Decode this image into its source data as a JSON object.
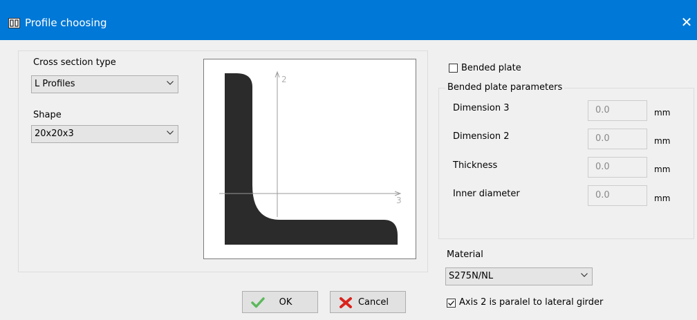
{
  "window": {
    "title": "Profile choosing",
    "close_glyph": "✕",
    "app_icon": "profile-app-icon"
  },
  "cross_section": {
    "label": "Cross section type",
    "value": "L Profiles"
  },
  "shape": {
    "label": "Shape",
    "value": "20x20x3"
  },
  "preview": {
    "axis_vertical": "2",
    "axis_horizontal": "3"
  },
  "bended_plate": {
    "checkbox_label": "Bended plate",
    "checked": false,
    "group_title": "Bended plate parameters",
    "params": [
      {
        "label": "Dimension 3",
        "value": "0.0",
        "unit": "mm"
      },
      {
        "label": "Dimension 2",
        "value": "0.0",
        "unit": "mm"
      },
      {
        "label": "Thickness",
        "value": "0.0",
        "unit": "mm"
      },
      {
        "label": "Inner diameter",
        "value": "0.0",
        "unit": "mm"
      }
    ]
  },
  "material": {
    "label": "Material",
    "value": "S275N/NL"
  },
  "axis_option": {
    "label": "Axis 2 is paralel to lateral girder",
    "checked": true
  },
  "buttons": {
    "ok": "OK",
    "cancel": "Cancel"
  },
  "colors": {
    "titlebar": "#0078d7",
    "ok_icon": "#5cb85c",
    "cancel_icon": "#d9231c"
  }
}
